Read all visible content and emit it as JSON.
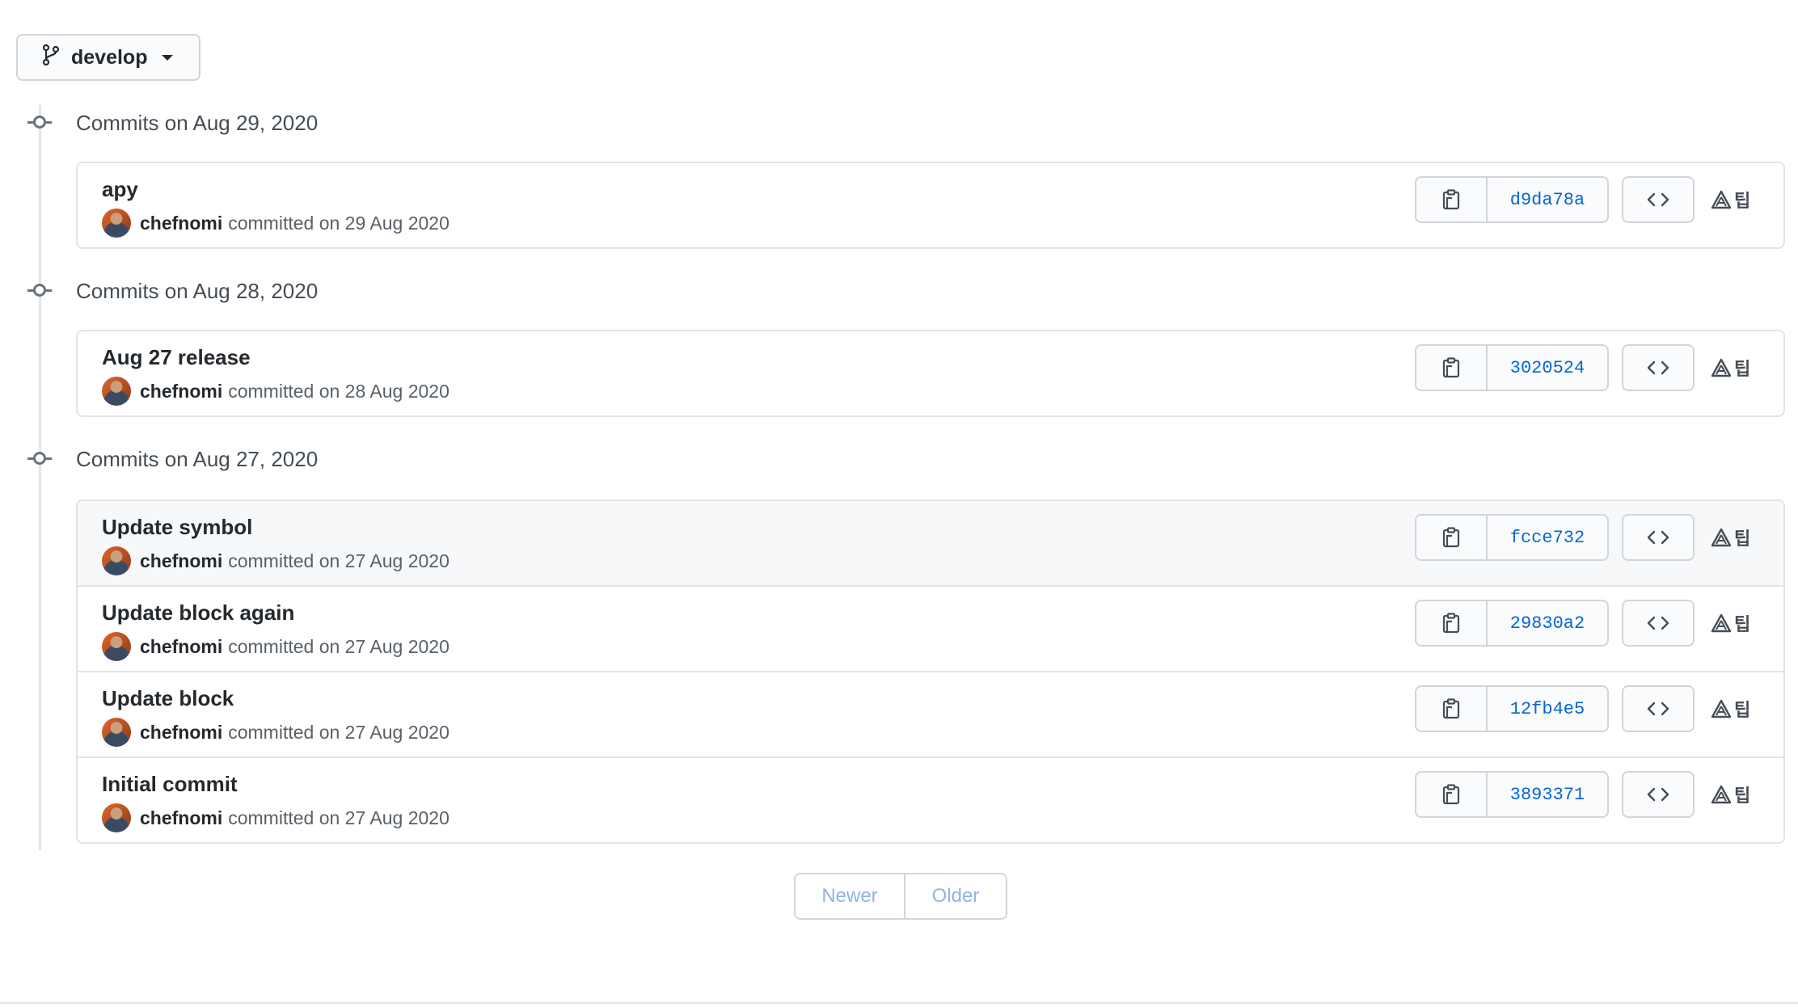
{
  "branch": {
    "name": "develop",
    "icon": "git-branch-icon"
  },
  "days": [
    {
      "title": "Commits on Aug 29, 2020",
      "commits": [
        {
          "message": "apy",
          "author": "chefnomi",
          "meta": "committed on 29 Aug 2020",
          "sha": "d9da78a",
          "highlighted": false
        }
      ]
    },
    {
      "title": "Commits on Aug 28, 2020",
      "commits": [
        {
          "message": "Aug 27 release",
          "author": "chefnomi",
          "meta": "committed on 28 Aug 2020",
          "sha": "3020524",
          "highlighted": false
        }
      ]
    },
    {
      "title": "Commits on Aug 27, 2020",
      "commits": [
        {
          "message": "Update symbol",
          "author": "chefnomi",
          "meta": "committed on 27 Aug 2020",
          "sha": "fcce732",
          "highlighted": true
        },
        {
          "message": "Update block again",
          "author": "chefnomi",
          "meta": "committed on 27 Aug 2020",
          "sha": "29830a2",
          "highlighted": false
        },
        {
          "message": "Update block",
          "author": "chefnomi",
          "meta": "committed on 27 Aug 2020",
          "sha": "12fb4e5",
          "highlighted": false
        },
        {
          "message": "Initial commit",
          "author": "chefnomi",
          "meta": "committed on 27 Aug 2020",
          "sha": "3893371",
          "highlighted": false
        }
      ]
    }
  ],
  "pagination": {
    "newer": "Newer",
    "older": "Older"
  },
  "icons": {
    "copy": "clipboard-icon",
    "browse": "code-icon",
    "extension": "extension-icon"
  },
  "extension_glyph": "팁",
  "colors": {
    "link": "#0366d6",
    "border": "#d1d5da",
    "disabled_link": "#8fb4e6"
  }
}
